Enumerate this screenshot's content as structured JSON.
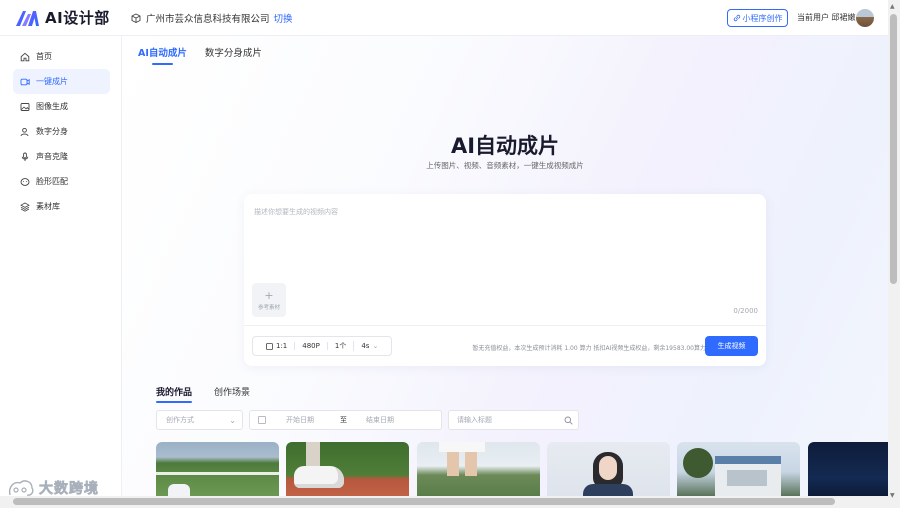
{
  "header": {
    "logo_text": "AI设计部",
    "company_name": "广州市芸众信息科技有限公司",
    "switch_label": "切换",
    "miniprogram_label": "小程序创作",
    "user_label": "当前用户 邱裙嫩"
  },
  "sidebar": {
    "items": [
      {
        "label": "首页",
        "icon": "home-icon"
      },
      {
        "label": "一键成片",
        "icon": "video-icon",
        "active": true
      },
      {
        "label": "图像生成",
        "icon": "image-icon"
      },
      {
        "label": "数字分身",
        "icon": "person-icon"
      },
      {
        "label": "声音克隆",
        "icon": "mic-icon"
      },
      {
        "label": "脸形匹配",
        "icon": "face-icon"
      },
      {
        "label": "素材库",
        "icon": "layers-icon"
      }
    ]
  },
  "main": {
    "tabs": [
      {
        "label": "AI自动成片",
        "active": true
      },
      {
        "label": "数字分身成片",
        "active": false
      }
    ],
    "hero_title": "AI自动成片",
    "hero_subtitle": "上传图片、视频、音频素材，一键生成视频成片",
    "editor": {
      "placeholder": "描述你想要生成的视频内容",
      "upload_label": "参考素材",
      "counter": "0/2000",
      "options": {
        "ratio": "1:1",
        "resolution": "480P",
        "count": "1个",
        "duration": "4s"
      },
      "hint": "暂无充值权益，本次生成预计消耗 1.00 算力 抵扣AI视频生成权益，剩余19583.00算力",
      "generate_label": "生成视频"
    },
    "works_tabs": [
      {
        "label": "我的作品",
        "active": true
      },
      {
        "label": "创作场景",
        "active": false
      }
    ],
    "filters": {
      "method_placeholder": "创作方式",
      "start_date": "开始日期",
      "to": "至",
      "end_date": "结束日期",
      "search_placeholder": "请输入标题"
    }
  },
  "watermark_text": "大数跨境",
  "colors": {
    "accent": "#2f6bff",
    "active_bg": "#eef3ff"
  }
}
